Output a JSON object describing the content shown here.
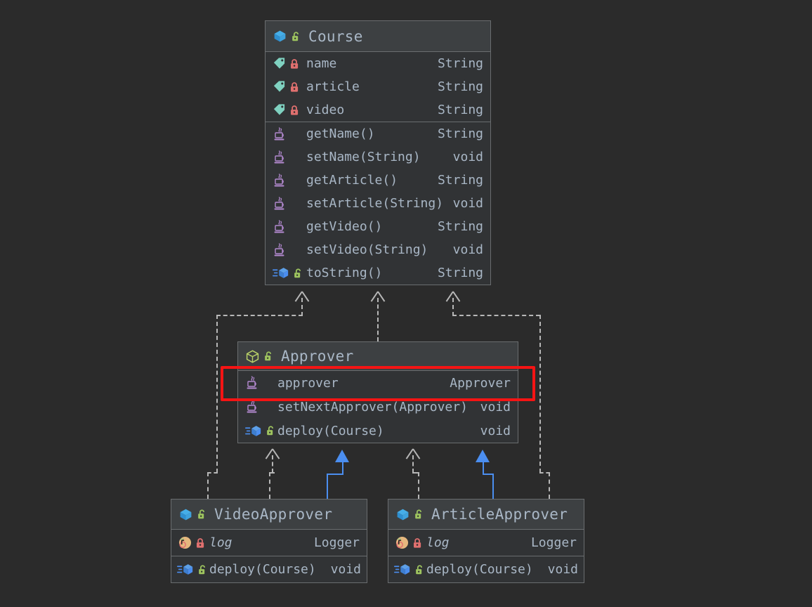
{
  "diagram": {
    "title": "UML class diagram",
    "background_color": "#2b2b2b",
    "box_fill": "#313335",
    "header_fill": "#3d4042",
    "border_color": "#6a6d6f",
    "text_color": "#a9b7c6",
    "highlight_color": "#f51414",
    "inherit_arrow_color": "#4b8ef0",
    "dependency_arrow_color": "#b7b7b7"
  },
  "classes": {
    "course": {
      "name": "Course",
      "header_icons": [
        "class-icon",
        "unlocked-padlock-icon"
      ],
      "fields": [
        {
          "icon": "field-tag-icon",
          "lock": "locked-padlock-icon",
          "name": "name",
          "type": "String"
        },
        {
          "icon": "field-tag-icon",
          "lock": "locked-padlock-icon",
          "name": "article",
          "type": "String"
        },
        {
          "icon": "field-tag-icon",
          "lock": "locked-padlock-icon",
          "name": "video",
          "type": "String"
        }
      ],
      "methods": [
        {
          "icon": "java-method-icon",
          "lock": "",
          "name": "getName()",
          "type": "String"
        },
        {
          "icon": "java-method-icon",
          "lock": "",
          "name": "setName(String)",
          "type": "void"
        },
        {
          "icon": "java-method-icon",
          "lock": "",
          "name": "getArticle()",
          "type": "String"
        },
        {
          "icon": "java-method-icon",
          "lock": "",
          "name": "setArticle(String)",
          "type": "void"
        },
        {
          "icon": "java-method-icon",
          "lock": "",
          "name": "getVideo()",
          "type": "String"
        },
        {
          "icon": "java-method-icon",
          "lock": "",
          "name": "setVideo(String)",
          "type": "void"
        },
        {
          "icon": "override-class-icon",
          "lock": "unlocked-padlock-icon",
          "name": "toString()",
          "type": "String"
        }
      ]
    },
    "approver": {
      "name": "Approver",
      "header_icons": [
        "interface-icon",
        "unlocked-padlock-icon"
      ],
      "members": [
        {
          "icon": "java-method-icon",
          "lock": "",
          "name": "approver",
          "type": "Approver",
          "highlighted": true
        },
        {
          "icon": "java-method-icon",
          "lock": "",
          "name": "setNextApprover(Approver)",
          "type": "void",
          "highlighted": false
        },
        {
          "icon": "override-interface-icon",
          "lock": "unlocked-padlock-icon",
          "name": "deploy(Course)",
          "type": "void",
          "highlighted": false
        }
      ]
    },
    "video_approver": {
      "name": "VideoApprover",
      "header_icons": [
        "class-icon",
        "unlocked-padlock-icon"
      ],
      "fields": [
        {
          "icon": "static-field-icon",
          "lock": "locked-padlock-icon",
          "name": "log",
          "type": "Logger",
          "italic": true
        }
      ],
      "methods": [
        {
          "icon": "override-class-icon",
          "lock": "unlocked-padlock-icon",
          "name": "deploy(Course)",
          "type": "void"
        }
      ]
    },
    "article_approver": {
      "name": "ArticleApprover",
      "header_icons": [
        "class-icon",
        "unlocked-padlock-icon"
      ],
      "fields": [
        {
          "icon": "static-field-icon",
          "lock": "locked-padlock-icon",
          "name": "log",
          "type": "Logger",
          "italic": true
        }
      ],
      "methods": [
        {
          "icon": "override-class-icon",
          "lock": "unlocked-padlock-icon",
          "name": "deploy(Course)",
          "type": "void"
        }
      ]
    }
  },
  "relationships": [
    {
      "from": "VideoApprover",
      "to": "Course",
      "kind": "dependency"
    },
    {
      "from": "Approver",
      "to": "Course",
      "kind": "dependency"
    },
    {
      "from": "ArticleApprover",
      "to": "Course",
      "kind": "dependency"
    },
    {
      "from": "VideoApprover",
      "to": "Approver",
      "kind": "dependency"
    },
    {
      "from": "VideoApprover",
      "to": "Approver",
      "kind": "realization"
    },
    {
      "from": "ArticleApprover",
      "to": "Approver",
      "kind": "dependency"
    },
    {
      "from": "ArticleApprover",
      "to": "Approver",
      "kind": "realization"
    }
  ]
}
